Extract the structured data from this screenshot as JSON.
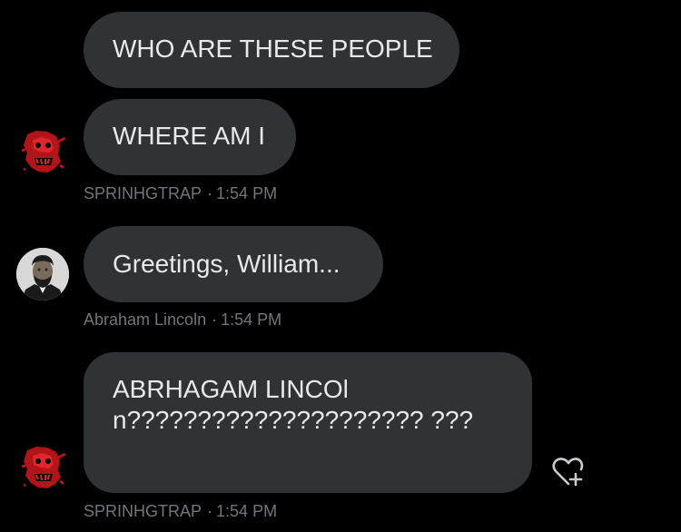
{
  "messages": [
    {
      "text": "WHO ARE THESE PEOPLE"
    },
    {
      "text": "WHERE AM I",
      "sender": "SPRINHGTRAP",
      "time": "1:54 PM"
    },
    {
      "text": "Greetings, William...",
      "sender": "Abraham Lincoln",
      "time": "1:54 PM"
    },
    {
      "text": "ABRHAGAM LINCOln????????????????????? ???",
      "sender": "SPRINHGTRAP",
      "time": "1:54 PM"
    }
  ],
  "meta_separator": "·",
  "colors": {
    "background": "#000000",
    "bubble": "#2f3336",
    "text": "#e7e9ea",
    "meta": "#71767b",
    "springtrap_red": "#c4161c"
  },
  "icons": {
    "springtrap_avatar": "springtrap-avatar",
    "lincoln_avatar": "lincoln-avatar",
    "reaction": "heart-plus-icon"
  }
}
